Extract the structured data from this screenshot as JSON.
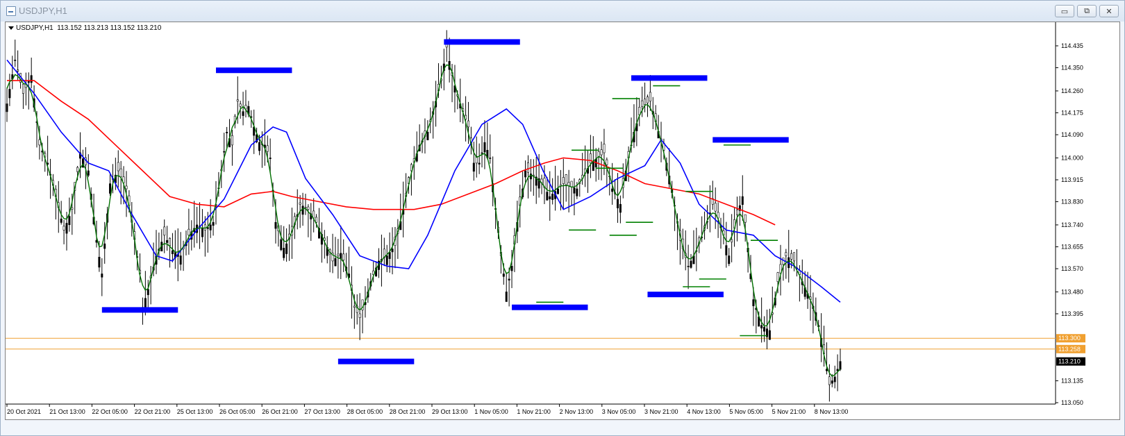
{
  "window": {
    "title": "USDJPY,H1",
    "buttons": {
      "minimize": "▭",
      "restore": "⧉",
      "close": "✕"
    },
    "icon": "chart-window-icon"
  },
  "chart_data": {
    "type": "line",
    "header": {
      "symbol": "USDJPY,H1",
      "ohlc": "113.152 113.213 113.152 113.210"
    },
    "ylim": [
      113.03,
      114.5
    ],
    "y_ticks": [
      "114.435",
      "114.350",
      "114.260",
      "114.175",
      "114.090",
      "114.000",
      "113.915",
      "113.830",
      "113.740",
      "113.655",
      "113.570",
      "113.480",
      "113.395",
      "113.300",
      "113.258",
      "113.210",
      "113.135",
      "113.050"
    ],
    "x_ticks": [
      "20 Oct 2021",
      "21 Oct 13:00",
      "22 Oct 05:00",
      "22 Oct 21:00",
      "25 Oct 13:00",
      "26 Oct 05:00",
      "26 Oct 21:00",
      "27 Oct 13:00",
      "28 Oct 05:00",
      "28 Oct 21:00",
      "29 Oct 13:00",
      "1 Nov 05:00",
      "1 Nov 21:00",
      "2 Nov 13:00",
      "3 Nov 05:00",
      "3 Nov 21:00",
      "4 Nov 13:00",
      "5 Nov 05:00",
      "5 Nov 21:00",
      "8 Nov 13:00"
    ],
    "bar_index_range": [
      0,
      382
    ],
    "price_series": [
      [
        0,
        114.21
      ],
      [
        6,
        114.38
      ],
      [
        12,
        114.25
      ],
      [
        18,
        114.32
      ],
      [
        24,
        114.05
      ],
      [
        30,
        113.98
      ],
      [
        36,
        113.85
      ],
      [
        42,
        113.72
      ],
      [
        48,
        113.8
      ],
      [
        54,
        114.02
      ],
      [
        60,
        113.95
      ],
      [
        66,
        113.68
      ],
      [
        70,
        113.55
      ],
      [
        76,
        113.9
      ],
      [
        82,
        113.95
      ],
      [
        88,
        113.88
      ],
      [
        92,
        113.75
      ],
      [
        98,
        113.55
      ],
      [
        100,
        113.42
      ],
      [
        104,
        113.49
      ],
      [
        110,
        113.62
      ],
      [
        116,
        113.7
      ],
      [
        122,
        113.64
      ],
      [
        128,
        113.62
      ],
      [
        134,
        113.7
      ],
      [
        140,
        113.74
      ],
      [
        146,
        113.72
      ],
      [
        152,
        113.75
      ],
      [
        158,
        113.95
      ],
      [
        162,
        114.1
      ],
      [
        166,
        114.05
      ],
      [
        170,
        114.22
      ],
      [
        174,
        114.18
      ],
      [
        178,
        114.2
      ],
      [
        182,
        114.12
      ],
      [
        186,
        114.06
      ],
      [
        190,
        114.05
      ],
      [
        194,
        114.0
      ],
      [
        198,
        113.75
      ],
      [
        204,
        113.65
      ],
      [
        210,
        113.7
      ],
      [
        216,
        113.82
      ],
      [
        222,
        113.8
      ],
      [
        228,
        113.75
      ],
      [
        234,
        113.68
      ],
      [
        240,
        113.6
      ],
      [
        246,
        113.63
      ],
      [
        252,
        113.55
      ],
      [
        256,
        113.42
      ],
      [
        260,
        113.38
      ],
      [
        264,
        113.44
      ],
      [
        268,
        113.52
      ],
      [
        274,
        113.6
      ],
      [
        280,
        113.62
      ],
      [
        286,
        113.66
      ],
      [
        292,
        113.8
      ],
      [
        298,
        113.95
      ],
      [
        304,
        114.05
      ],
      [
        310,
        114.1
      ],
      [
        316,
        114.22
      ],
      [
        320,
        114.3
      ],
      [
        324,
        114.43
      ],
      [
        328,
        114.32
      ],
      [
        332,
        114.24
      ],
      [
        336,
        114.18
      ],
      [
        340,
        114.12
      ],
      [
        344,
        113.98
      ],
      [
        348,
        113.98
      ],
      [
        352,
        114.06
      ],
      [
        356,
        114.0
      ],
      [
        360,
        113.8
      ],
      [
        364,
        113.62
      ],
      [
        368,
        113.48
      ],
      [
        372,
        113.58
      ],
      [
        376,
        113.75
      ],
      [
        380,
        113.88
      ],
      [
        382,
        113.95
      ]
    ],
    "series": [
      {
        "name": "",
        "color": "#ff0000",
        "kind": "ma_slow"
      },
      {
        "name": "",
        "color": "#0000ff",
        "kind": "ma_mid"
      },
      {
        "name": "",
        "color": "#007000",
        "kind": "ma_fast"
      }
    ],
    "ma_slow": [
      [
        0,
        114.3
      ],
      [
        20,
        114.3
      ],
      [
        40,
        114.22
      ],
      [
        60,
        114.15
      ],
      [
        80,
        114.05
      ],
      [
        100,
        113.95
      ],
      [
        120,
        113.85
      ],
      [
        140,
        113.82
      ],
      [
        160,
        113.81
      ],
      [
        180,
        113.86
      ],
      [
        196,
        113.87
      ],
      [
        210,
        113.85
      ],
      [
        230,
        113.83
      ],
      [
        250,
        113.81
      ],
      [
        270,
        113.8
      ],
      [
        290,
        113.8
      ],
      [
        300,
        113.8
      ],
      [
        320,
        113.82
      ],
      [
        340,
        113.86
      ],
      [
        360,
        113.9
      ],
      [
        380,
        113.95
      ],
      [
        396,
        113.98
      ],
      [
        410,
        114.0
      ],
      [
        430,
        113.99
      ],
      [
        450,
        113.95
      ],
      [
        470,
        113.9
      ],
      [
        490,
        113.88
      ],
      [
        510,
        113.86
      ],
      [
        530,
        113.82
      ],
      [
        550,
        113.78
      ],
      [
        566,
        113.74
      ]
    ],
    "ma_mid": [
      [
        0,
        114.38
      ],
      [
        20,
        114.25
      ],
      [
        40,
        114.1
      ],
      [
        60,
        113.98
      ],
      [
        75,
        113.95
      ],
      [
        90,
        113.8
      ],
      [
        110,
        113.62
      ],
      [
        122,
        113.6
      ],
      [
        140,
        113.72
      ],
      [
        160,
        113.84
      ],
      [
        180,
        114.05
      ],
      [
        196,
        114.12
      ],
      [
        206,
        114.1
      ],
      [
        220,
        113.92
      ],
      [
        240,
        113.78
      ],
      [
        260,
        113.62
      ],
      [
        280,
        113.58
      ],
      [
        296,
        113.57
      ],
      [
        310,
        113.7
      ],
      [
        330,
        113.95
      ],
      [
        350,
        114.13
      ],
      [
        368,
        114.19
      ],
      [
        380,
        114.13
      ],
      [
        395,
        113.95
      ],
      [
        410,
        113.8
      ],
      [
        430,
        113.85
      ],
      [
        450,
        113.92
      ],
      [
        470,
        113.97
      ],
      [
        482,
        114.07
      ],
      [
        496,
        113.98
      ],
      [
        510,
        113.82
      ],
      [
        530,
        113.72
      ],
      [
        550,
        113.7
      ],
      [
        566,
        113.62
      ],
      [
        580,
        113.58
      ],
      [
        600,
        113.5
      ],
      [
        614,
        113.44
      ]
    ],
    "horizontal_levels": [
      {
        "price": 113.3,
        "color": "#f0a030",
        "label": "113.300"
      },
      {
        "price": 113.258,
        "color": "#f0a030",
        "label": "113.258"
      }
    ],
    "current_price": {
      "price": 113.21,
      "label": "113.210"
    },
    "blue_zones": [
      {
        "bar_from": 70,
        "bar_to": 126,
        "price": 113.41
      },
      {
        "bar_from": 154,
        "bar_to": 210,
        "price": 114.34
      },
      {
        "bar_from": 244,
        "bar_to": 300,
        "price": 113.21
      },
      {
        "bar_from": 322,
        "bar_to": 378,
        "price": 114.45
      },
      {
        "bar_from": 372,
        "bar_to": 428,
        "price": 113.42
      },
      {
        "bar_from": 460,
        "bar_to": 516,
        "price": 114.31
      },
      {
        "bar_from": 472,
        "bar_to": 528,
        "price": 113.47
      },
      {
        "bar_from": 520,
        "bar_to": 576,
        "price": 114.07
      }
    ],
    "green_marks": [
      {
        "bar_from": 416,
        "bar_to": 436,
        "price": 114.03
      },
      {
        "bar_from": 434,
        "bar_to": 454,
        "price": 113.96
      },
      {
        "bar_from": 414,
        "bar_to": 434,
        "price": 113.72
      },
      {
        "bar_from": 444,
        "bar_to": 464,
        "price": 113.7
      },
      {
        "bar_from": 446,
        "bar_to": 466,
        "price": 114.23
      },
      {
        "bar_from": 456,
        "bar_to": 476,
        "price": 113.75
      },
      {
        "bar_from": 476,
        "bar_to": 496,
        "price": 114.28
      },
      {
        "bar_from": 390,
        "bar_to": 410,
        "price": 113.44
      },
      {
        "bar_from": 500,
        "bar_to": 520,
        "price": 113.87
      },
      {
        "bar_from": 498,
        "bar_to": 518,
        "price": 113.5
      },
      {
        "bar_from": 510,
        "bar_to": 530,
        "price": 113.53
      },
      {
        "bar_from": 528,
        "bar_to": 548,
        "price": 114.05
      },
      {
        "bar_from": 548,
        "bar_to": 568,
        "price": 113.68
      },
      {
        "bar_from": 540,
        "bar_to": 560,
        "price": 113.31
      }
    ]
  }
}
